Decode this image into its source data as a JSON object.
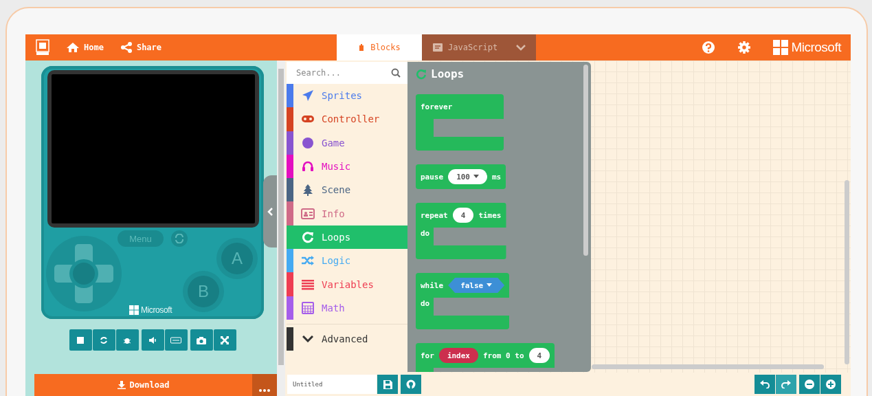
{
  "header": {
    "nav": [
      {
        "label": "Home"
      },
      {
        "label": "Share"
      }
    ],
    "tabs": [
      {
        "label": "Blocks",
        "selected": true
      },
      {
        "label": "JavaScript",
        "selected": false
      }
    ],
    "brand": "Microsoft"
  },
  "simulator": {
    "menu_label": "Menu",
    "buttons": [
      "A",
      "B"
    ],
    "brand": "Microsoft",
    "download": "Download"
  },
  "toolbox": {
    "search_placeholder": "Search...",
    "categories": [
      {
        "name": "Sprites",
        "color": "#4b7bec",
        "selected": false
      },
      {
        "name": "Controller",
        "color": "#d54322",
        "selected": false
      },
      {
        "name": "Game",
        "color": "#8854d0",
        "selected": false
      },
      {
        "name": "Music",
        "color": "#e30fc0",
        "selected": false
      },
      {
        "name": "Scene",
        "color": "#4b6584",
        "selected": false
      },
      {
        "name": "Info",
        "color": "#cf6a87",
        "selected": false
      },
      {
        "name": "Loops",
        "color": "#20bf6b",
        "selected": true
      },
      {
        "name": "Logic",
        "color": "#45aaf2",
        "selected": false
      },
      {
        "name": "Variables",
        "color": "#ee3d52",
        "selected": false
      },
      {
        "name": "Math",
        "color": "#a55eea",
        "selected": false
      }
    ],
    "advanced": "Advanced"
  },
  "flyout": {
    "title": "Loops",
    "blocks": [
      {
        "kind": "c-block",
        "header": [
          {
            "kind": "label",
            "text": "forever"
          }
        ]
      },
      {
        "kind": "statement",
        "header": [
          {
            "kind": "label",
            "text": "pause"
          },
          {
            "kind": "dropdown",
            "text": "100"
          },
          {
            "kind": "label",
            "text": "ms"
          }
        ]
      },
      {
        "kind": "c-block",
        "header": [
          {
            "kind": "label",
            "text": "repeat"
          },
          {
            "kind": "number",
            "text": "4"
          },
          {
            "kind": "label",
            "text": "times"
          }
        ],
        "do_label": "do"
      },
      {
        "kind": "c-block",
        "header": [
          {
            "kind": "label",
            "text": "while"
          },
          {
            "kind": "boolean",
            "text": "false"
          }
        ],
        "do_label": "do"
      },
      {
        "kind": "c-block",
        "header": [
          {
            "kind": "label",
            "text": "for"
          },
          {
            "kind": "variable",
            "text": "index"
          },
          {
            "kind": "label",
            "text": "from 0 to"
          },
          {
            "kind": "number",
            "text": "4"
          }
        ]
      }
    ]
  },
  "editor": {
    "project_name": "Untitled"
  }
}
